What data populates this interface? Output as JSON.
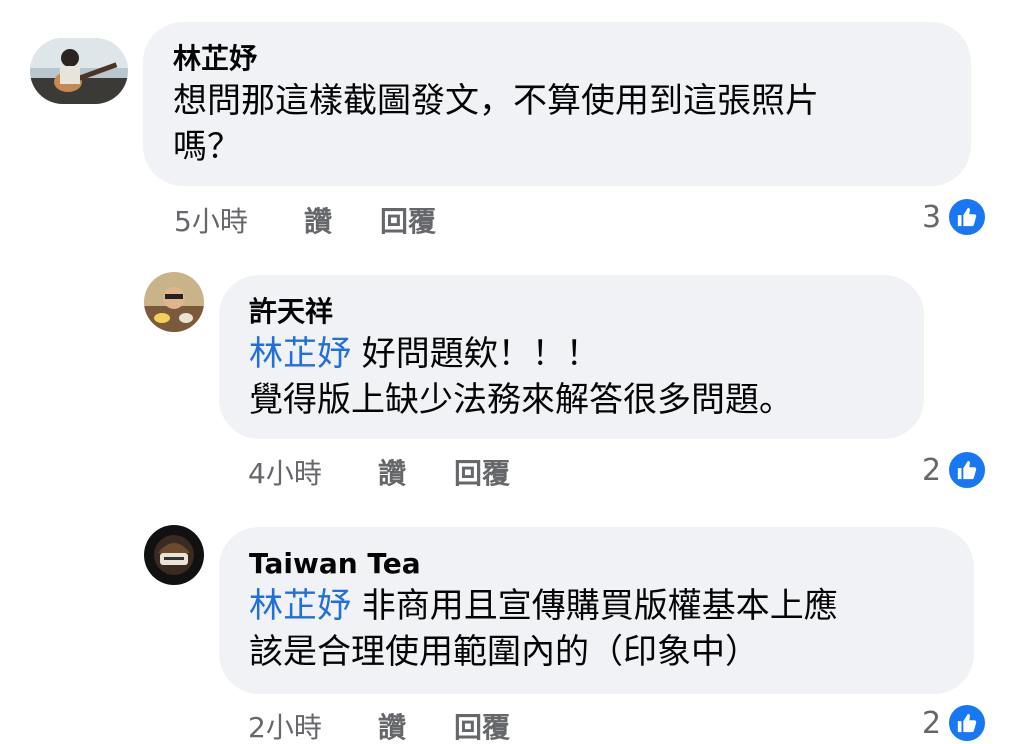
{
  "comments": [
    {
      "author": "林芷妤",
      "mention": "",
      "lines": [
        "想問那這樣截圖發文，不算使用到這張照片",
        "嗎？"
      ],
      "time": "5小時",
      "like_label": "讚",
      "reply_label": "回覆",
      "reaction_count": "3"
    },
    {
      "author": "許天祥",
      "mention": "林芷妤",
      "lines": [
        " 好問題欸！！！",
        "覺得版上缺少法務來解答很多問題。"
      ],
      "time": "4小時",
      "like_label": "讚",
      "reply_label": "回覆",
      "reaction_count": "2"
    },
    {
      "author": "Taiwan Tea",
      "mention": "林芷妤",
      "lines": [
        " 非商用且宣傳購買版權基本上應",
        "該是合理使用範圍內的（印象中）"
      ],
      "time": "2小時",
      "like_label": "讚",
      "reply_label": "回覆",
      "reaction_count": "2"
    }
  ],
  "colors": {
    "bubble": "#f0f2f5",
    "mention": "#216fdb",
    "like_badge": "#1877f2",
    "meta": "#65676b"
  },
  "icons": [
    "thumbs-up-icon"
  ]
}
